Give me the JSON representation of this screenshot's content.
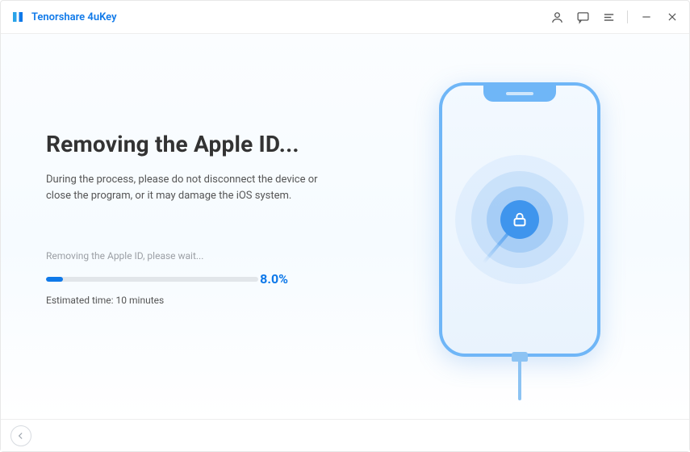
{
  "app": {
    "brand": "Tenorshare 4uKey"
  },
  "titlebar": {
    "icons": {
      "account": "person-icon",
      "feedback": "chat-icon",
      "menu": "menu-icon",
      "minimize": "minimize-icon",
      "close": "close-icon"
    }
  },
  "main": {
    "title": "Removing the Apple ID...",
    "description": "During the process, please do not disconnect the device or close the program, or it may damage the iOS system.",
    "status": "Removing the Apple ID, please wait...",
    "progress_percent": 8.0,
    "progress_percent_label": "8.0%",
    "estimated_time": "Estimated time: 10 minutes"
  },
  "illustration": {
    "center_icon": "lock-icon"
  },
  "footer": {
    "back": "back-button"
  },
  "colors": {
    "accent": "#0f79e9",
    "phone_border": "#6fb6f7",
    "ring_core": "#3f95ed"
  }
}
